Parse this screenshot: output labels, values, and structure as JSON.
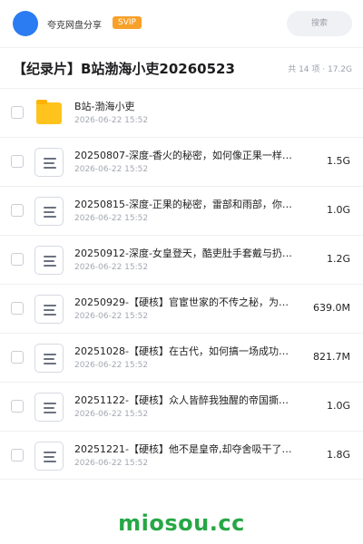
{
  "header": {
    "user_name": "夸克网盘分享",
    "badge": "SVIP",
    "search_placeholder": "搜索"
  },
  "folder": {
    "title": "【纪录片】B站渤海小吏20260523",
    "meta": "共 14 项 · 17.2G"
  },
  "items": [
    {
      "type": "folder",
      "name": "B站-渤海小吏",
      "date": "2026-06-22 15:52",
      "size": ""
    },
    {
      "type": "file",
      "name": "20250807-深度-香火的秘密，如何像正果一样…",
      "date": "2026-06-22 15:52",
      "size": "1.5G"
    },
    {
      "type": "file",
      "name": "20250815-深度-正果的秘密，雷部和雨部，你…",
      "date": "2026-06-22 15:52",
      "size": "1.0G"
    },
    {
      "type": "file",
      "name": "20250912-深度-女皇登天，酷吏肚手套戴与扔…",
      "date": "2026-06-22 15:52",
      "size": "1.2G"
    },
    {
      "type": "file",
      "name": "20250929-【硬核】官宦世家的不传之秘，为什…",
      "date": "2026-06-22 15:52",
      "size": "639.0M"
    },
    {
      "type": "file",
      "name": "20251028-【硬核】在古代，如何搞一场成功的…",
      "date": "2026-06-22 15:52",
      "size": "821.7M"
    },
    {
      "type": "file",
      "name": "20251122-【硬核】众人皆醉我独醒的帝国撕裂…",
      "date": "2026-06-22 15:52",
      "size": "1.0G"
    },
    {
      "type": "file",
      "name": "20251221-【硬核】他不是皇帝,却夺舍吸干了…",
      "date": "2026-06-22 15:52",
      "size": "1.8G"
    }
  ],
  "watermark": "miosou.cc",
  "colors": {
    "avatar": "#2b7bf3",
    "badge": "#f7a12a",
    "folder_icon": "#ffc31d",
    "watermark": "#27a745"
  }
}
